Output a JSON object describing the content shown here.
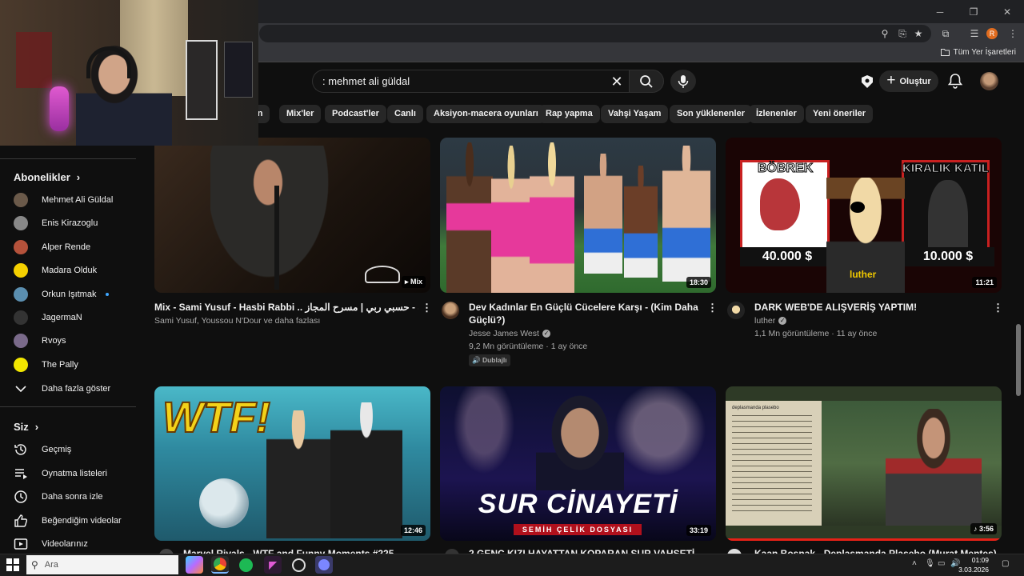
{
  "browser": {
    "bookmark_all": "Tüm Yer İşaretleri",
    "profile_letter": "R"
  },
  "header": {
    "search_value": ": mehmet ali güldal",
    "create_label": "Oluştur"
  },
  "chips": [
    "un",
    "Mix'ler",
    "Podcast'ler",
    "Canlı",
    "Aksiyon-macera oyunları",
    "Rap yapma",
    "Vahşi Yaşam",
    "Son yüklenenler",
    "İzlenenler",
    "Yeni öneriler"
  ],
  "sidebar": {
    "subs_heading": "Abonelikler",
    "subs": [
      {
        "label": "Mehmet Ali Güldal",
        "color": "#6b5a4a"
      },
      {
        "label": "Enis Kirazoglu",
        "color": "#888888"
      },
      {
        "label": "Alper Rende",
        "color": "#b5523b"
      },
      {
        "label": "Madara Olduk",
        "color": "#f5d000"
      },
      {
        "label": "Orkun Işıtmak",
        "color": "#5b8fb0"
      },
      {
        "label": "JagermaN",
        "color": "#333333"
      },
      {
        "label": "Rvoys",
        "color": "#7a6a8a"
      },
      {
        "label": "The Pally",
        "color": "#f1e600"
      }
    ],
    "show_more": "Daha fazla göster",
    "you_heading": "Siz",
    "you_items": [
      {
        "label": "Geçmiş",
        "icon": "history-icon"
      },
      {
        "label": "Oynatma listeleri",
        "icon": "playlists-icon"
      },
      {
        "label": "Daha sonra izle",
        "icon": "watch-later-icon"
      },
      {
        "label": "Beğendiğim videolar",
        "icon": "like-icon"
      },
      {
        "label": "Videolarınız",
        "icon": "your-videos-icon"
      }
    ]
  },
  "videos": [
    {
      "title": "Mix - Sami Yusuf - Hasbi Rabbi .. سامي يوسف - حسبي ربي | مسرح المجاز",
      "channel": "Sami Yusuf, Youssou N'Dour ve daha fazlası",
      "stats": "",
      "duration": "Mix",
      "badge": ""
    },
    {
      "title": "Dev Kadınlar En Güçlü Cücelere Karşı - (Kim Daha Güçlü?)",
      "channel": "Jesse James West",
      "stats": "9,2 Mn görüntüleme · 1 ay önce",
      "duration": "18:30",
      "badge": "Dublajlı"
    },
    {
      "title": "DARK WEB'DE ALIŞVERİŞ YAPTIM!",
      "channel": "luther",
      "stats": "1,1 Mn görüntüleme · 11 ay önce",
      "duration": "11:21",
      "badge": "",
      "thumb_text": {
        "left": "BÖBREK",
        "right": "KIRALIK KATIL",
        "price_left": "40.000 $",
        "price_right": "10.000 $",
        "name": "luther"
      }
    },
    {
      "title": "Marvel Rivals - WTF and Funny Moments #225",
      "duration": "12:46",
      "thumb_text": "WTF!"
    },
    {
      "title": "2 GENÇ KIZI HAYATTAN KOPARAN SUR VAHŞETİ -",
      "duration": "33:19",
      "thumb_text": "SUR CİNAYETİ",
      "thumb_sub": "SEMİH ÇELİK DOSYASI"
    },
    {
      "title": "Kaan Boşnak - Deplasmanda Plasebo (Murat Menteş)",
      "duration": "3:56",
      "thumb_text": "deplasmanda plasebo"
    }
  ],
  "taskbar": {
    "search_placeholder": "Ara",
    "time": "01:09",
    "date": "3.03.2026"
  }
}
